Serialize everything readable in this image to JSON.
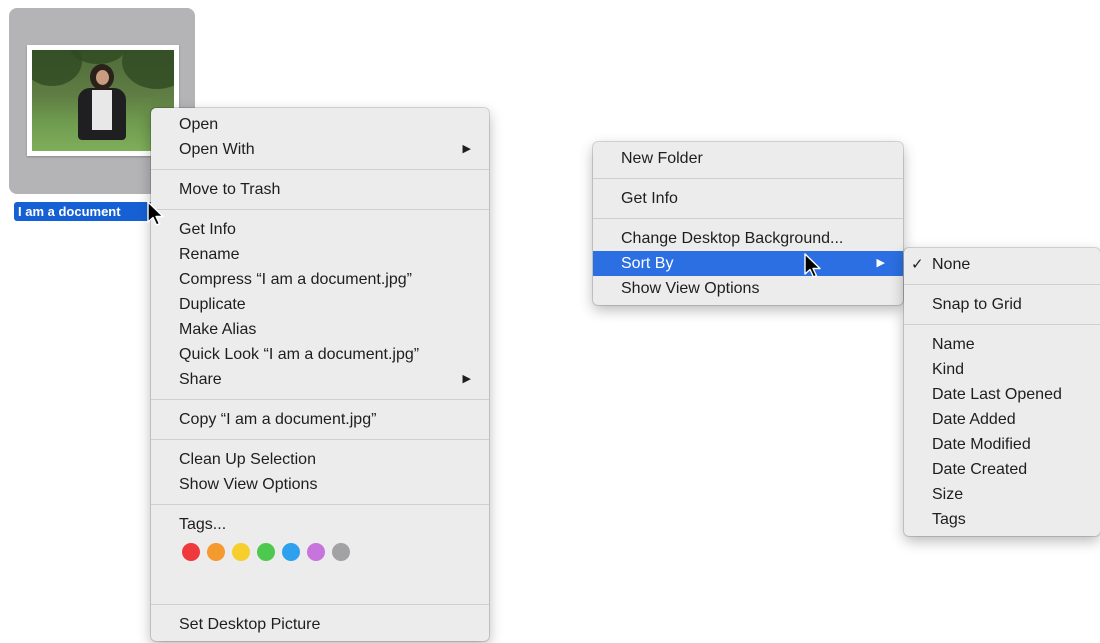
{
  "file": {
    "name": "I am a document.jpg",
    "label": "I am a document"
  },
  "file_menu": {
    "items": {
      "open": "Open",
      "open_with": "Open With",
      "move_to_trash": "Move to Trash",
      "get_info": "Get Info",
      "rename": "Rename",
      "compress": "Compress “I am a document.jpg”",
      "duplicate": "Duplicate",
      "make_alias": "Make Alias",
      "quick_look": "Quick Look “I am a document.jpg”",
      "share": "Share",
      "copy": "Copy “I am a document.jpg”",
      "clean_up_selection": "Clean Up Selection",
      "show_view_options": "Show View Options",
      "tags": "Tags...",
      "set_desktop_picture": "Set Desktop Picture"
    },
    "submenu_arrow": "▶",
    "tag_colors": [
      {
        "name": "red",
        "color": "#f0393c"
      },
      {
        "name": "orange",
        "color": "#f59a2e"
      },
      {
        "name": "yellow",
        "color": "#f6cf2d"
      },
      {
        "name": "green",
        "color": "#4cc94e"
      },
      {
        "name": "blue",
        "color": "#2ea1ee"
      },
      {
        "name": "purple",
        "color": "#c774dc"
      },
      {
        "name": "gray",
        "color": "#a2a2a4"
      }
    ]
  },
  "desktop_menu": {
    "items": {
      "new_folder": "New Folder",
      "get_info": "Get Info",
      "change_background": "Change Desktop Background...",
      "sort_by": "Sort By",
      "show_view_options": "Show View Options"
    },
    "submenu_arrow": "▶",
    "highlight_color": "#2b6fe3"
  },
  "sort_submenu": {
    "check_mark": "✓",
    "selected": "None",
    "items": {
      "none": "None",
      "snap_to_grid": "Snap to Grid",
      "name": "Name",
      "kind": "Kind",
      "date_last_opened": "Date Last Opened",
      "date_added": "Date Added",
      "date_modified": "Date Modified",
      "date_created": "Date Created",
      "size": "Size",
      "tags": "Tags"
    }
  }
}
